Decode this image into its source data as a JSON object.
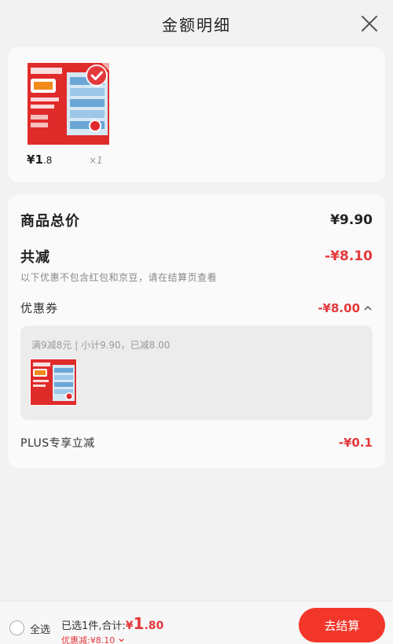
{
  "header": {
    "title": "金额明细"
  },
  "product": {
    "price_symbol": "¥",
    "price_int": "1",
    "price_dec": ".8",
    "quantity": "×1"
  },
  "detail": {
    "total_label": "商品总价",
    "total_value": "¥9.90",
    "reduce_label": "共减",
    "reduce_value": "-¥8.10",
    "note": "以下优惠不包含红包和京豆，请在结算页查看",
    "coupon_label": "优惠券",
    "coupon_value": "-¥8.00",
    "coupon_desc": "满9减8元 | 小计9.90，已减8.00",
    "plus_label": "PLUS专享立减",
    "plus_value": "-¥0.1"
  },
  "bottom": {
    "select_all": "全选",
    "summary_prefix": "已选1件,合计:",
    "price_symbol": "¥",
    "price_int": "1",
    "price_dec": ".80",
    "discount": "优惠减:¥8.10",
    "checkout": "去结算"
  },
  "colors": {
    "accent_red": "#e4393c",
    "button_red": "#f2362a",
    "card_bg": "#fafafa",
    "page_bg": "#f2f2f2"
  },
  "icons": [
    "close-icon",
    "chevron-up-icon",
    "chevron-down-icon",
    "checkbox-circle-icon",
    "check-badge-icon"
  ]
}
